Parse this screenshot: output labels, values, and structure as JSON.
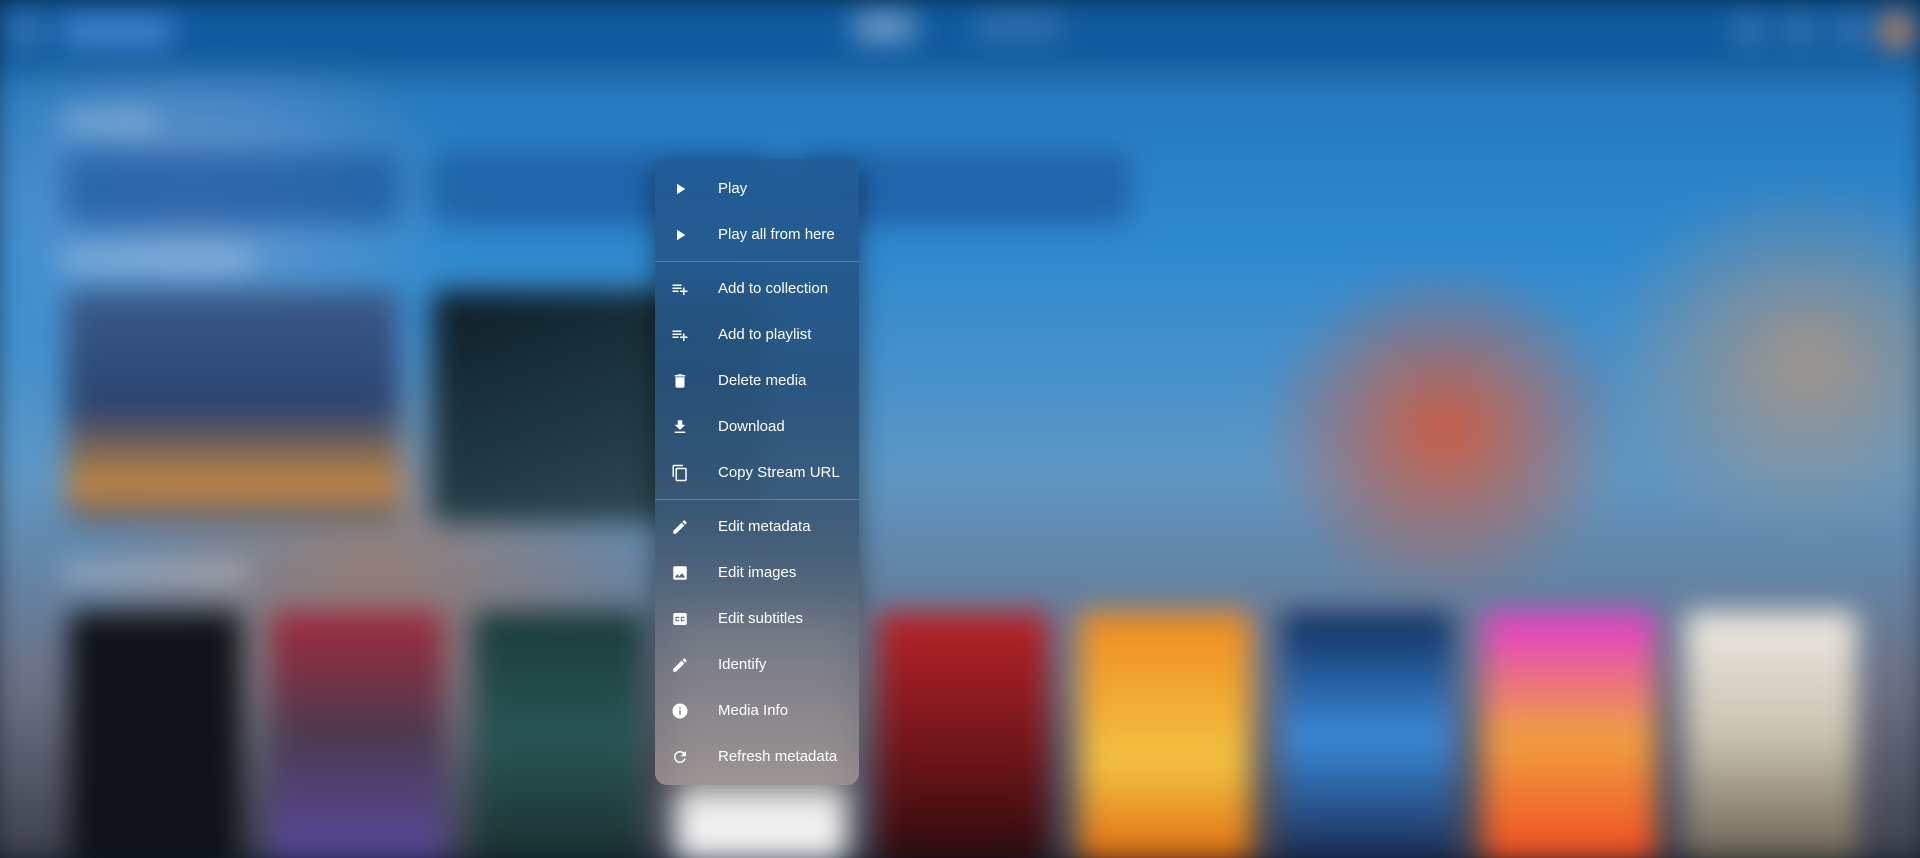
{
  "context_menu": {
    "items": [
      {
        "label": "Play",
        "icon": "play-icon"
      },
      {
        "label": "Play all from here",
        "icon": "play-icon"
      },
      {
        "label": "Add to collection",
        "icon": "playlist-add-icon"
      },
      {
        "label": "Add to playlist",
        "icon": "playlist-add-icon"
      },
      {
        "label": "Delete media",
        "icon": "trash-icon"
      },
      {
        "label": "Download",
        "icon": "download-icon"
      },
      {
        "label": "Copy Stream URL",
        "icon": "copy-icon"
      },
      {
        "label": "Edit metadata",
        "icon": "pencil-icon"
      },
      {
        "label": "Edit images",
        "icon": "image-icon"
      },
      {
        "label": "Edit subtitles",
        "icon": "closed-caption-icon"
      },
      {
        "label": "Identify",
        "icon": "pencil-icon"
      },
      {
        "label": "Media Info",
        "icon": "info-icon"
      },
      {
        "label": "Refresh metadata",
        "icon": "refresh-icon"
      }
    ]
  },
  "colors": {
    "topbar": "#0f5aa0",
    "menu_top": "#225c96",
    "menu_bottom": "#968c8c",
    "menu_text": "#ffffff"
  }
}
